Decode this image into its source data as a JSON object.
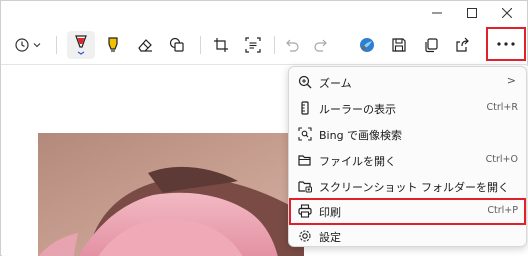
{
  "toolbar": {
    "history_icon": "clock-icon",
    "more_label": "…"
  },
  "menu": {
    "items": [
      {
        "label": "ズーム",
        "shortcut": "",
        "submenu": ">"
      },
      {
        "label": "ルーラーの表示",
        "shortcut": "Ctrl+R"
      },
      {
        "label": "Bing で画像検索",
        "shortcut": ""
      },
      {
        "label": "ファイルを開く",
        "shortcut": "Ctrl+O"
      },
      {
        "label": "スクリーンショット フォルダーを開く",
        "shortcut": ""
      },
      {
        "label": "印刷",
        "shortcut": "Ctrl+P"
      },
      {
        "label": "設定",
        "shortcut": ""
      }
    ]
  },
  "colors": {
    "highlight": "#e0202a",
    "pen_red": "#e2232a",
    "highlighter_yellow": "#f2c200"
  }
}
